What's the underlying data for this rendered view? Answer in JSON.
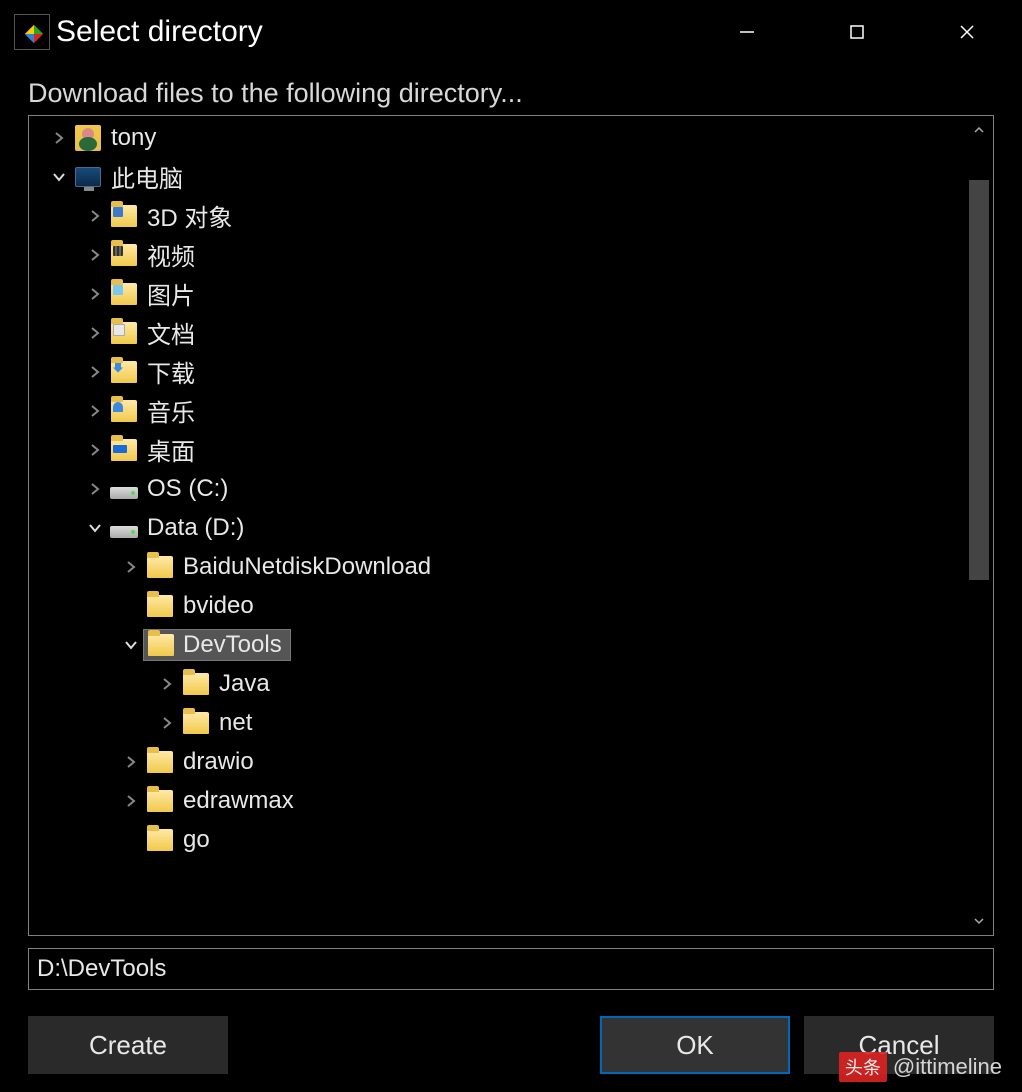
{
  "window": {
    "title": "Select directory"
  },
  "instruction": "Download files to the following directory...",
  "tree": [
    {
      "indent": 0,
      "expander": "collapsed",
      "icon": "user",
      "label": "tony",
      "selected": false
    },
    {
      "indent": 0,
      "expander": "expanded",
      "icon": "pc",
      "label": "此电脑",
      "selected": false
    },
    {
      "indent": 1,
      "expander": "collapsed",
      "icon": "lib-blue",
      "label": "3D 对象",
      "selected": false
    },
    {
      "indent": 1,
      "expander": "collapsed",
      "icon": "lib-vid",
      "label": "视频",
      "selected": false
    },
    {
      "indent": 1,
      "expander": "collapsed",
      "icon": "lib-pic",
      "label": "图片",
      "selected": false
    },
    {
      "indent": 1,
      "expander": "collapsed",
      "icon": "lib-doc",
      "label": "文档",
      "selected": false
    },
    {
      "indent": 1,
      "expander": "collapsed",
      "icon": "lib-dl",
      "label": "下载",
      "selected": false
    },
    {
      "indent": 1,
      "expander": "collapsed",
      "icon": "lib-mus",
      "label": "音乐",
      "selected": false
    },
    {
      "indent": 1,
      "expander": "collapsed",
      "icon": "lib-desk",
      "label": "桌面",
      "selected": false
    },
    {
      "indent": 1,
      "expander": "collapsed",
      "icon": "drive",
      "label": "OS (C:)",
      "selected": false
    },
    {
      "indent": 1,
      "expander": "expanded",
      "icon": "drive",
      "label": "Data (D:)",
      "selected": false
    },
    {
      "indent": 2,
      "expander": "collapsed",
      "icon": "folder",
      "label": "BaiduNetdiskDownload",
      "selected": false
    },
    {
      "indent": 2,
      "expander": "none",
      "icon": "folder",
      "label": "bvideo",
      "selected": false
    },
    {
      "indent": 2,
      "expander": "expanded",
      "icon": "folder",
      "label": "DevTools",
      "selected": true
    },
    {
      "indent": 3,
      "expander": "collapsed",
      "icon": "folder",
      "label": "Java",
      "selected": false
    },
    {
      "indent": 3,
      "expander": "collapsed",
      "icon": "folder",
      "label": "net",
      "selected": false
    },
    {
      "indent": 2,
      "expander": "collapsed",
      "icon": "folder",
      "label": "drawio",
      "selected": false
    },
    {
      "indent": 2,
      "expander": "collapsed",
      "icon": "folder",
      "label": "edrawmax",
      "selected": false
    },
    {
      "indent": 2,
      "expander": "none",
      "icon": "folder",
      "label": "go",
      "selected": false
    }
  ],
  "path_input": "D:\\DevTools",
  "buttons": {
    "create": "Create",
    "ok": "OK",
    "cancel": "Cancel"
  },
  "watermark": "@ittimeline",
  "watermark_prefix": "头条"
}
